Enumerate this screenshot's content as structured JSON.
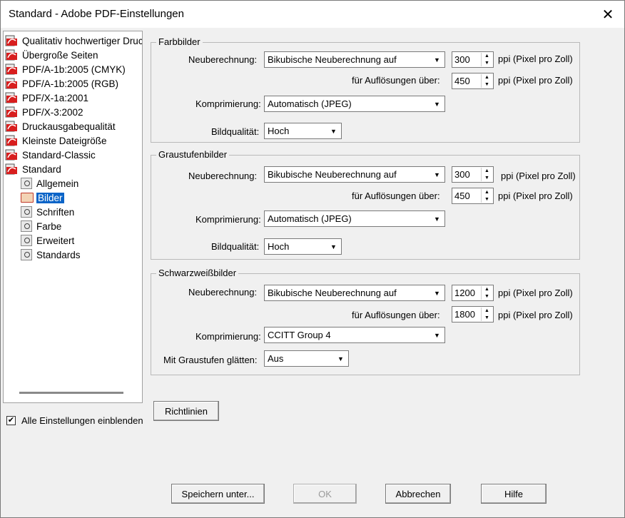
{
  "window": {
    "title": "Standard - Adobe PDF-Einstellungen",
    "close_glyph": "✕"
  },
  "tree": {
    "presets": [
      "Qualitativ hochwertiger Druc",
      "Übergroße Seiten",
      "PDF/A-1b:2005 (CMYK)",
      "PDF/A-1b:2005 (RGB)",
      "PDF/X-1a:2001",
      "PDF/X-3:2002",
      "Druckausgabequalität",
      "Kleinste Dateigröße",
      "Standard-Classic",
      "Standard"
    ],
    "children": [
      "Allgemein",
      "Bilder",
      "Schriften",
      "Farbe",
      "Erweitert",
      "Standards"
    ],
    "selected": "Bilder"
  },
  "show_all": {
    "label": "Alle Einstellungen einblenden",
    "checked": true
  },
  "guidelines_button": "Richtlinien",
  "color": {
    "title": "Farbbilder",
    "resample_label": "Neuberechnung:",
    "resample_value": "Bikubische Neuberechnung auf",
    "ppi_value": "300",
    "ppi_unit": "ppi (Pixel pro Zoll)",
    "above_label": "für Auflösungen über:",
    "above_value": "450",
    "above_unit": "ppi (Pixel pro Zoll)",
    "compression_label": "Komprimierung:",
    "compression_value": "Automatisch (JPEG)",
    "quality_label": "Bildqualität:",
    "quality_value": "Hoch"
  },
  "gray": {
    "title": "Graustufenbilder",
    "resample_label": "Neuberechnung:",
    "resample_value": "Bikubische Neuberechnung auf",
    "ppi_value": "300",
    "ppi_unit": "ppi (Pixel pro Zoll)",
    "above_label": "für Auflösungen über:",
    "above_value": "450",
    "above_unit": "ppi (Pixel pro Zoll)",
    "compression_label": "Komprimierung:",
    "compression_value": "Automatisch (JPEG)",
    "quality_label": "Bildqualität:",
    "quality_value": "Hoch"
  },
  "mono": {
    "title": "Schwarzweißbilder",
    "resample_label": "Neuberechnung:",
    "resample_value": "Bikubische Neuberechnung auf",
    "ppi_value": "1200",
    "ppi_unit": "ppi (Pixel pro Zoll)",
    "above_label": "für Auflösungen über:",
    "above_value": "1800",
    "above_unit": "ppi (Pixel pro Zoll)",
    "compression_label": "Komprimierung:",
    "compression_value": "CCITT Group 4",
    "smooth_label": "Mit Graustufen glätten:",
    "smooth_value": "Aus"
  },
  "buttons": {
    "save_as": "Speichern unter...",
    "ok": "OK",
    "cancel": "Abbrechen",
    "help": "Hilfe"
  }
}
